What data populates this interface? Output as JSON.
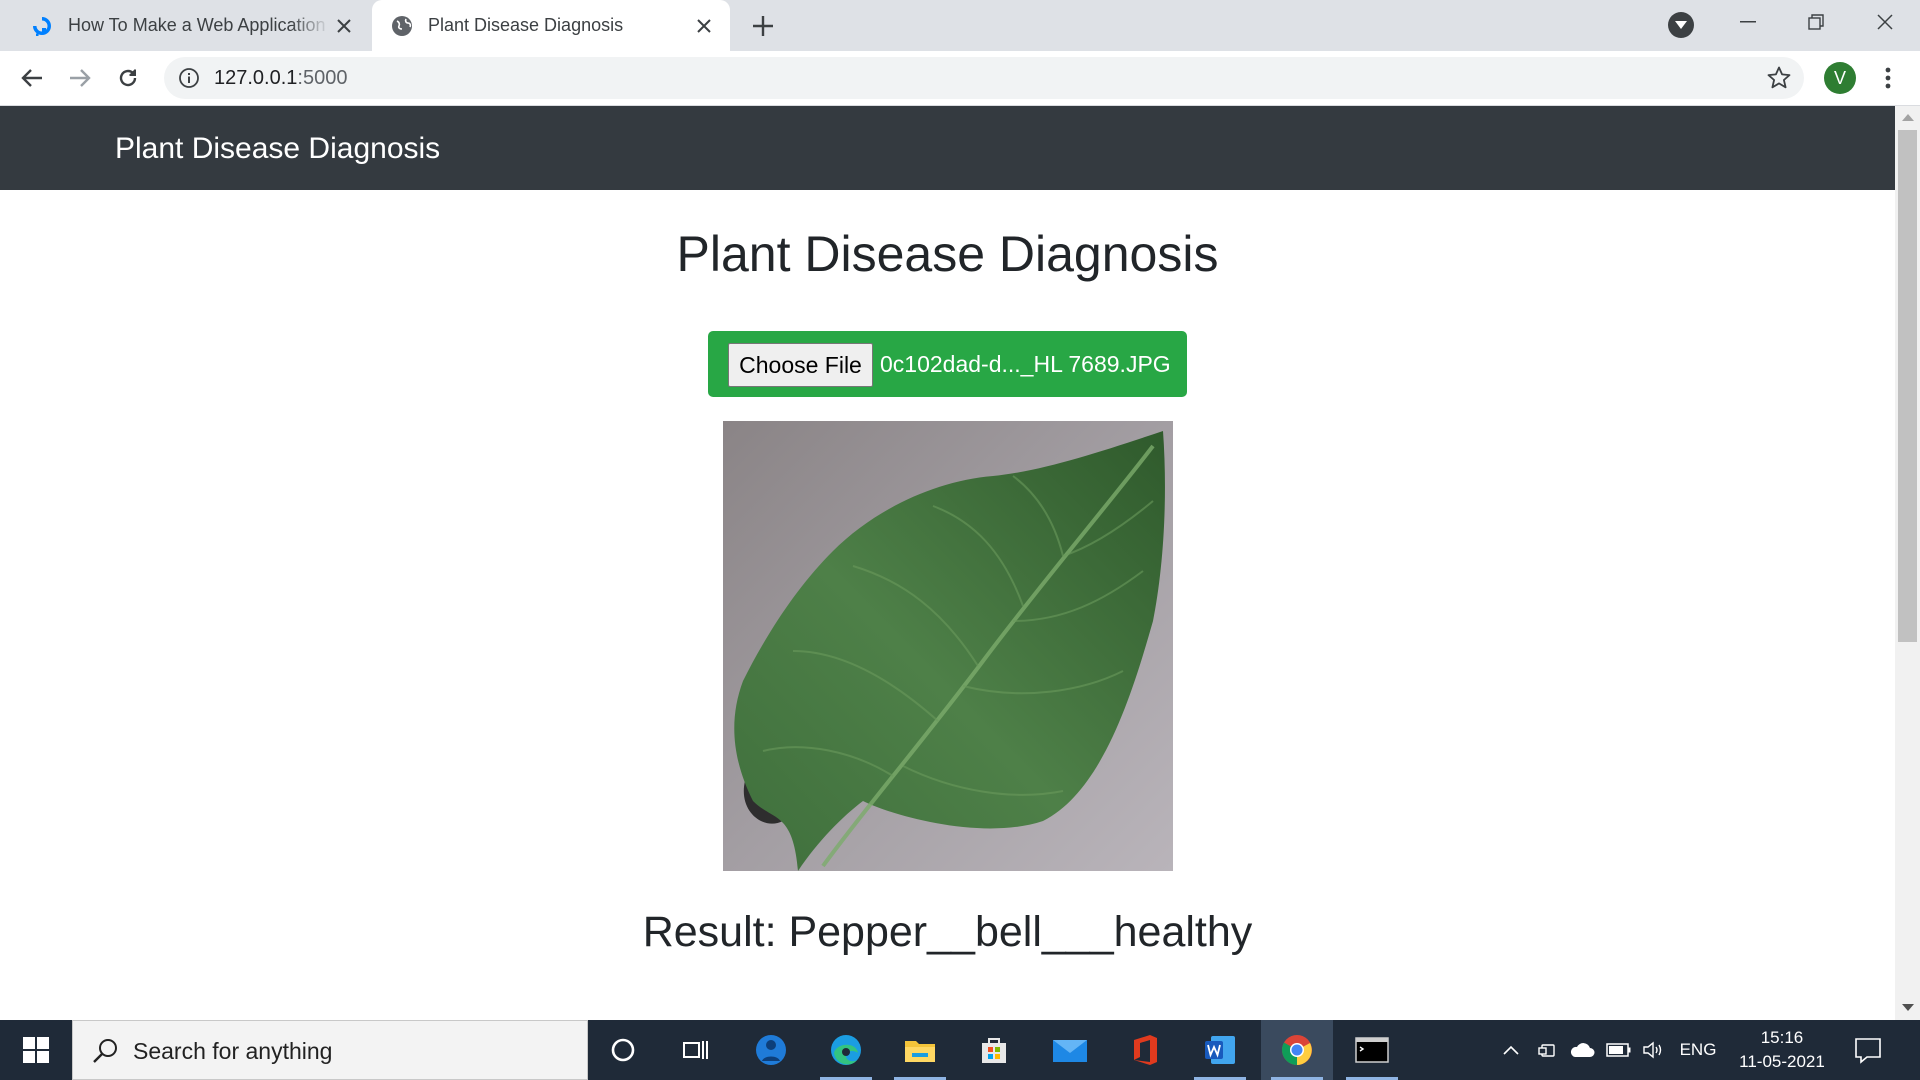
{
  "browser": {
    "tabs": [
      {
        "title": "How To Make a Web Application",
        "favicon": "digitalocean-icon",
        "active": false
      },
      {
        "title": "Plant Disease Diagnosis",
        "favicon": "globe-icon",
        "active": true
      }
    ],
    "address_bar": {
      "host": "127.0.0.1",
      "port": ":5000"
    },
    "profile_initial": "V"
  },
  "page": {
    "navbar_brand": "Plant Disease Diagnosis",
    "heading": "Plant Disease Diagnosis",
    "file_input": {
      "button_label": "Choose File",
      "file_name": "0c102dad-d..._HL 7689.JPG"
    },
    "result_text": "Result: Pepper__bell___healthy"
  },
  "taskbar": {
    "search_placeholder": "Search for anything",
    "apps": [
      "cortana-icon",
      "task-view-icon",
      "azure-data-studio-icon",
      "edge-icon",
      "file-explorer-icon",
      "store-icon",
      "mail-icon",
      "office-icon",
      "word-icon",
      "chrome-icon",
      "terminal-icon"
    ],
    "tray": {
      "language": "ENG",
      "time": "15:16",
      "date": "11-05-2021"
    }
  },
  "colors": {
    "navbar": "#343a40",
    "file_box": "#28a745",
    "tab_strip": "#dee1e6",
    "taskbar": "#1f2a38",
    "avatar": "#2e7d32"
  }
}
